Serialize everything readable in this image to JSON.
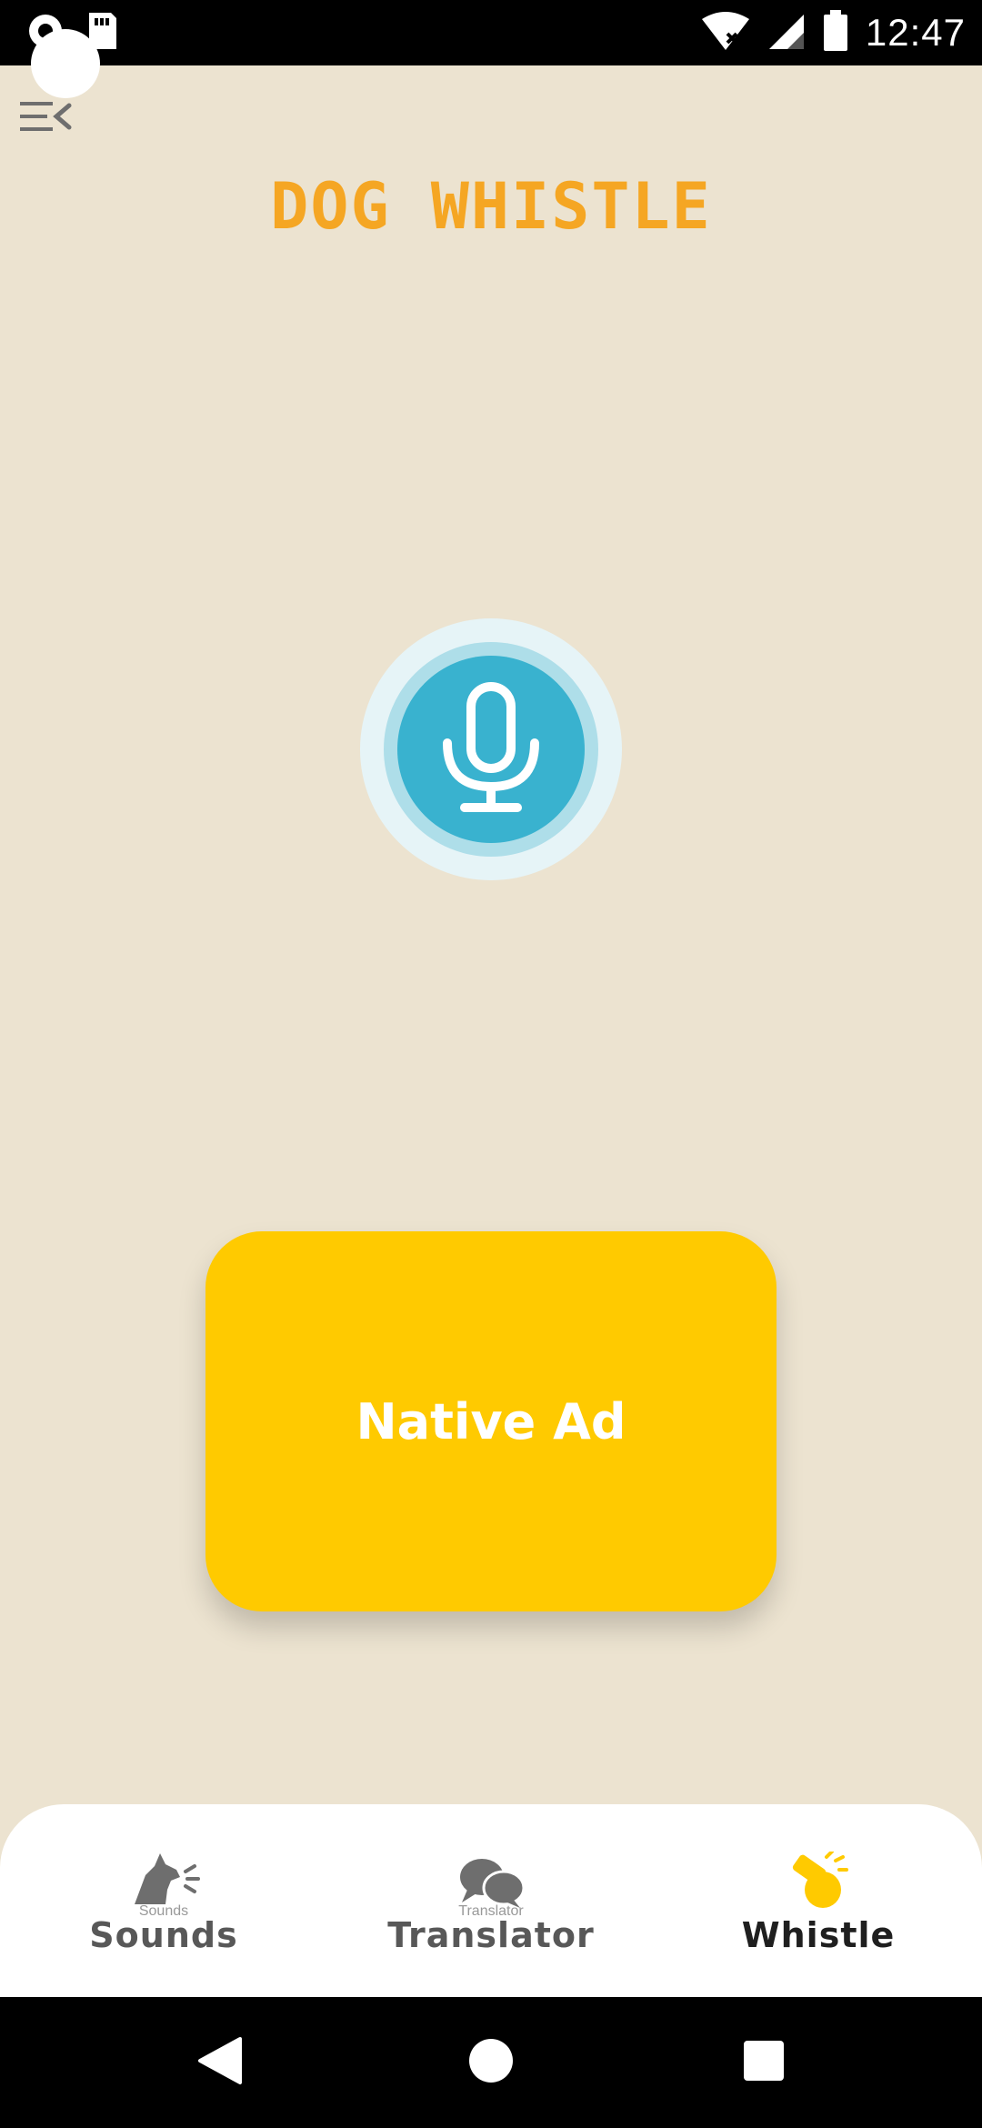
{
  "status_bar": {
    "time": "12:47",
    "icons": [
      "camera-icon",
      "sd-card-icon",
      "wifi-off-icon",
      "signal-icon",
      "battery-icon"
    ]
  },
  "header": {
    "title": "DOG WHISTLE",
    "menu_icon": "menu-collapse-icon"
  },
  "mic": {
    "icon": "microphone-icon",
    "colors": {
      "outer": "#E6F4F7",
      "ring": "#AEDEE9",
      "core": "#39B2CF"
    }
  },
  "ad": {
    "label": "Native Ad",
    "color": "#FFCA00"
  },
  "bottom_nav": {
    "items": [
      {
        "key": "sounds",
        "label": "Sounds",
        "micro": "Sounds",
        "icon": "dog-barking-icon",
        "active": false
      },
      {
        "key": "translator",
        "label": "Translator",
        "micro": "Translator",
        "icon": "chat-bubbles-icon",
        "active": false
      },
      {
        "key": "whistle",
        "label": "Whistle",
        "micro": "",
        "icon": "whistle-icon",
        "active": true
      }
    ]
  },
  "system_nav": {
    "buttons": [
      "back-icon",
      "home-icon",
      "recents-icon"
    ]
  },
  "colors": {
    "background": "#ECE3D0",
    "title": "#F5A623",
    "inactive_icon": "#6E6E6E",
    "active_icon": "#FFCA00"
  }
}
